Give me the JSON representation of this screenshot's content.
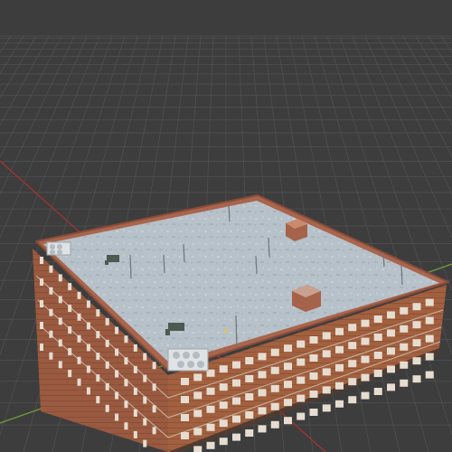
{
  "viewport": {
    "background": "#3d3d3d",
    "grid_color": "#505050",
    "x_axis_color": "#9a3535",
    "y_axis_color": "#6e9a3a"
  },
  "scene": {
    "object": "building",
    "roof_color": "#b9c3ca",
    "parapet_color": "#a7654d",
    "brick_color": "#9a5a40",
    "window_color": "#e8e2d8",
    "roof_props": [
      "rooftop-ac-unit",
      "rooftop-vent",
      "rooftop-hatch",
      "antenna-pole"
    ]
  }
}
